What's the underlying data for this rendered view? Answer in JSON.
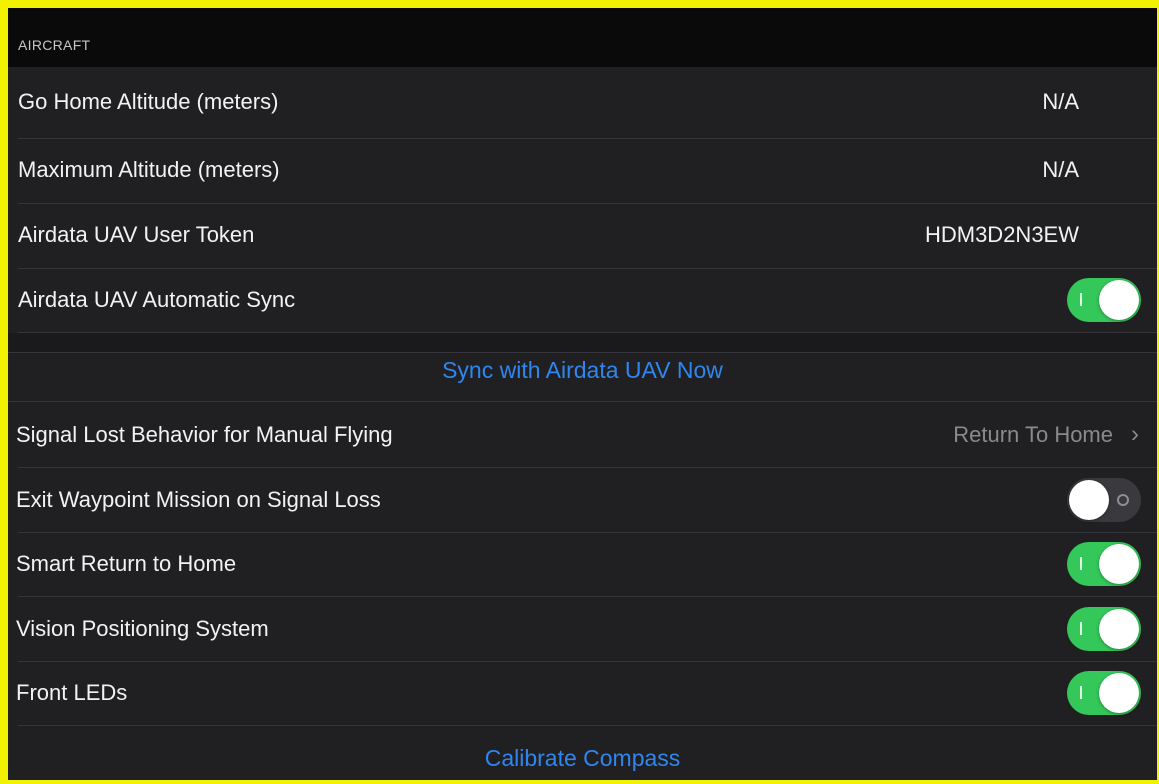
{
  "section": {
    "header": "AIRCRAFT"
  },
  "rows": [
    {
      "label": "Go Home Altitude (meters)",
      "value": "N/A"
    },
    {
      "label": "Maximum Altitude (meters)",
      "value": "N/A"
    },
    {
      "label": "Airdata UAV User Token",
      "value": "HDM3D2N3EW"
    },
    {
      "label": "Airdata UAV Automatic Sync",
      "toggle": "on"
    }
  ],
  "sync_action": "Sync with Airdata UAV Now",
  "rows2": [
    {
      "label": "Signal Lost Behavior for Manual Flying",
      "value": "Return To Home",
      "chevron": "chevron-right-icon"
    },
    {
      "label": "Exit Waypoint Mission on Signal Loss",
      "toggle": "off"
    },
    {
      "label": "Smart Return to Home",
      "toggle": "on"
    },
    {
      "label": "Vision Positioning System",
      "toggle": "on"
    },
    {
      "label": "Front LEDs",
      "toggle": "on"
    }
  ],
  "calibrate_action": "Calibrate Compass",
  "colors": {
    "accent": "#2f86ee",
    "toggle_on": "#34c759",
    "frame": "#f2f200"
  }
}
